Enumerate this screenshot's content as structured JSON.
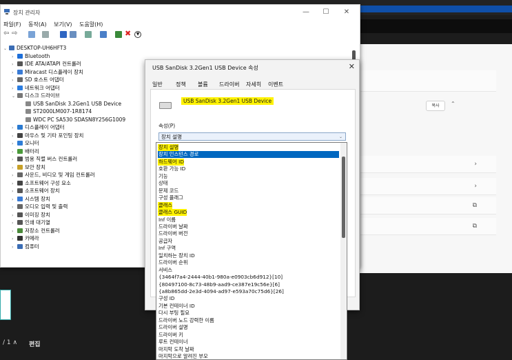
{
  "devmgr": {
    "title": "장치 관리자",
    "menu": [
      "파일(F)",
      "동작(A)",
      "보기(V)",
      "도움말(H)"
    ],
    "tree": [
      {
        "label": "DESKTOP-UH6HFT3",
        "level": 0,
        "arrow": "⌄",
        "icon": "computer-icon",
        "color": "#3b6db5"
      },
      {
        "label": "Bluetooth",
        "level": 1,
        "arrow": "›",
        "icon": "bluetooth-icon",
        "color": "#1e6fd9"
      },
      {
        "label": "IDE ATA/ATAPI 컨트롤러",
        "level": 1,
        "arrow": "›",
        "icon": "ide-controller-icon",
        "color": "#555"
      },
      {
        "label": "Miracast 디스플레이 장치",
        "level": 1,
        "arrow": "›",
        "icon": "display-device-icon",
        "color": "#3a7bd5"
      },
      {
        "label": "SD 호스트 어댑터",
        "level": 1,
        "arrow": "›",
        "icon": "sd-adapter-icon",
        "color": "#666"
      },
      {
        "label": "네트워크 어댑터",
        "level": 1,
        "arrow": "›",
        "icon": "network-adapter-icon",
        "color": "#2b7de0"
      },
      {
        "label": "디스크 드라이브",
        "level": 1,
        "arrow": "⌄",
        "icon": "disk-drive-icon",
        "color": "#777"
      },
      {
        "label": "USB  SanDisk 3.2Gen1 USB Device",
        "level": 2,
        "arrow": "",
        "icon": "drive-icon",
        "color": "#888"
      },
      {
        "label": "ST2000LM007-1R8174",
        "level": 2,
        "arrow": "",
        "icon": "drive-icon",
        "color": "#888"
      },
      {
        "label": "WDC PC SA530 SDASN8Y256G1009",
        "level": 2,
        "arrow": "",
        "icon": "drive-icon",
        "color": "#888"
      },
      {
        "label": "디스플레이 어댑터",
        "level": 1,
        "arrow": "›",
        "icon": "display-adapter-icon",
        "color": "#2a7ad0"
      },
      {
        "label": "마우스 및 기타 포인팅 장치",
        "level": 1,
        "arrow": "›",
        "icon": "mouse-icon",
        "color": "#444"
      },
      {
        "label": "모니터",
        "level": 1,
        "arrow": "›",
        "icon": "monitor-icon",
        "color": "#2e7dd6"
      },
      {
        "label": "배터리",
        "level": 1,
        "arrow": "›",
        "icon": "battery-icon",
        "color": "#4a9a3a"
      },
      {
        "label": "범용 직렬 버스 컨트롤러",
        "level": 1,
        "arrow": "›",
        "icon": "usb-controller-icon",
        "color": "#555"
      },
      {
        "label": "보안 장치",
        "level": 1,
        "arrow": "›",
        "icon": "security-device-icon",
        "color": "#c7a028"
      },
      {
        "label": "사운드, 비디오 및 게임 컨트롤러",
        "level": 1,
        "arrow": "›",
        "icon": "speaker-icon",
        "color": "#666"
      },
      {
        "label": "소프트웨어 구성 요소",
        "level": 1,
        "arrow": "›",
        "icon": "software-component-icon",
        "color": "#444"
      },
      {
        "label": "소프트웨어 장치",
        "level": 1,
        "arrow": "›",
        "icon": "software-device-icon",
        "color": "#555"
      },
      {
        "label": "시스템 장치",
        "level": 1,
        "arrow": "›",
        "icon": "system-device-icon",
        "color": "#3a7bd5"
      },
      {
        "label": "오디오 입력 및 출력",
        "level": 1,
        "arrow": "›",
        "icon": "audio-icon",
        "color": "#666"
      },
      {
        "label": "이미징 장치",
        "level": 1,
        "arrow": "›",
        "icon": "camera-icon",
        "color": "#555"
      },
      {
        "label": "인쇄 대기열",
        "level": 1,
        "arrow": "›",
        "icon": "printer-icon",
        "color": "#555"
      },
      {
        "label": "저장소 컨트롤러",
        "level": 1,
        "arrow": "›",
        "icon": "storage-controller-icon",
        "color": "#4a8a3a"
      },
      {
        "label": "카메라",
        "level": 1,
        "arrow": "›",
        "icon": "webcam-icon",
        "color": "#333"
      },
      {
        "label": "컴퓨터",
        "level": 1,
        "arrow": "›",
        "icon": "computer-icon",
        "color": "#3b6db5"
      }
    ]
  },
  "props": {
    "title": "USB  SanDisk 3.2Gen1 USB Device 속성",
    "tabs": [
      "일반",
      "정책",
      "볼륨",
      "드라이버",
      "자세히",
      "이벤트"
    ],
    "device_name": "USB  SanDisk 3.2Gen1 USB Device",
    "property_label": "속성(P)",
    "selected_property": "장치 설명"
  },
  "droplist": {
    "items": [
      {
        "label": "장치 설명",
        "style": "hl"
      },
      {
        "label": "장치 인스턴스 경로",
        "style": "sel"
      },
      {
        "label": "하드웨어 ID",
        "style": "hl"
      },
      {
        "label": "호환 가능 ID",
        "style": ""
      },
      {
        "label": "기능",
        "style": ""
      },
      {
        "label": "상태",
        "style": ""
      },
      {
        "label": "문제 코드",
        "style": ""
      },
      {
        "label": "구성 플래그",
        "style": ""
      },
      {
        "label": "클래스",
        "style": "hl"
      },
      {
        "label": "클래스 GUID",
        "style": "hl"
      },
      {
        "label": "Inf 이름",
        "style": ""
      },
      {
        "label": "드라이버 날짜",
        "style": ""
      },
      {
        "label": "드라이버 버전",
        "style": ""
      },
      {
        "label": "공급자",
        "style": ""
      },
      {
        "label": "Inf 구역",
        "style": ""
      },
      {
        "label": "일치하는 장치 ID",
        "style": ""
      },
      {
        "label": "드라이버 순위",
        "style": ""
      },
      {
        "label": "서비스",
        "style": ""
      },
      {
        "label": "{3464f7a4-2444-40b1-980a-e0903cb6d912}[10]",
        "style": ""
      },
      {
        "label": "{80497100-8c73-48b9-aad9-ce387e19c56e}[6]",
        "style": ""
      },
      {
        "label": "{a8b865dd-2e3d-4094-ad97-e593a70c75d6}[26]",
        "style": ""
      },
      {
        "label": "구성 ID",
        "style": ""
      },
      {
        "label": "기본 컨테이너 ID",
        "style": ""
      },
      {
        "label": "다시 부팅 필요",
        "style": ""
      },
      {
        "label": "드라이버 노드 강력한 이름",
        "style": ""
      },
      {
        "label": "드라이버 설명",
        "style": ""
      },
      {
        "label": "드라이버 키",
        "style": ""
      },
      {
        "label": "루트 컨테이너",
        "style": ""
      },
      {
        "label": "마지막 도착 날짜",
        "style": ""
      },
      {
        "label": "마지막으로 알려진 부모",
        "style": ""
      }
    ]
  },
  "background": {
    "copy_button": "복사",
    "page_indicator": "/ 1 ∧",
    "edit_label": "편집"
  }
}
